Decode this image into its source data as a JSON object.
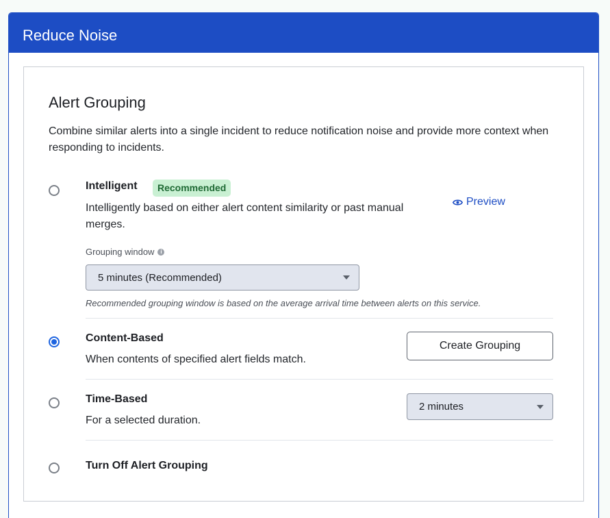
{
  "header": {
    "title": "Reduce Noise"
  },
  "section": {
    "title": "Alert Grouping",
    "description": "Combine similar alerts into a single incident to reduce notification noise and provide more context when responding to incidents."
  },
  "options": {
    "intelligent": {
      "title": "Intelligent",
      "badge": "Recommended",
      "description": "Intelligently based on either alert content similarity or past manual merges.",
      "preview_label": "Preview",
      "grouping_window_label": "Grouping window",
      "grouping_window_value": "5 minutes (Recommended)",
      "hint": "Recommended grouping window is based on the average arrival time between alerts on this service.",
      "selected": false
    },
    "content_based": {
      "title": "Content-Based",
      "description": "When contents of specified alert fields match.",
      "button_label": "Create Grouping",
      "selected": true
    },
    "time_based": {
      "title": "Time-Based",
      "description": "For a selected duration.",
      "duration_value": "2 minutes",
      "selected": false
    },
    "off": {
      "title": "Turn Off Alert Grouping",
      "selected": false
    }
  },
  "colors": {
    "header_bg": "#1d4dc4",
    "accent": "#1d64e0",
    "badge_bg": "#c9f0d3",
    "badge_text": "#1f6a35"
  }
}
